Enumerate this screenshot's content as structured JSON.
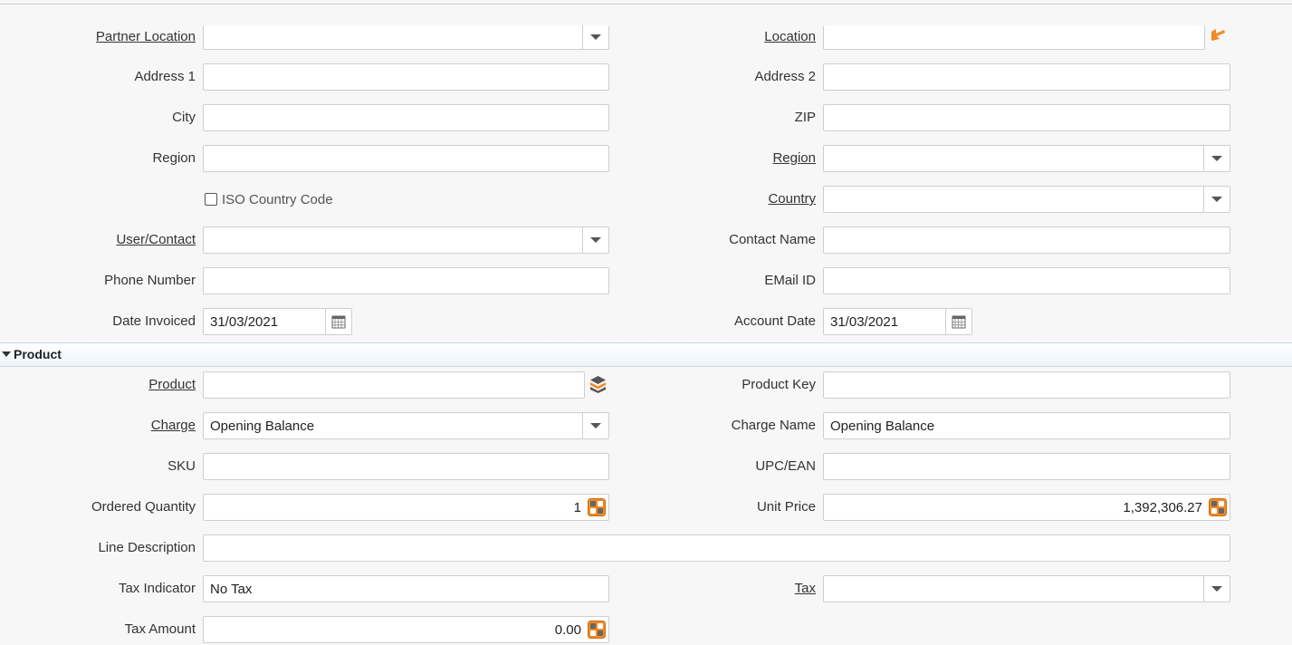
{
  "address": {
    "partner_location": {
      "label": "Partner Location",
      "value": ""
    },
    "location": {
      "label": "Location",
      "value": ""
    },
    "address1": {
      "label": "Address 1",
      "value": ""
    },
    "address2": {
      "label": "Address 2",
      "value": ""
    },
    "city": {
      "label": "City",
      "value": ""
    },
    "zip": {
      "label": "ZIP",
      "value": ""
    },
    "region_text": {
      "label": "Region",
      "value": ""
    },
    "region_select": {
      "label": "Region",
      "value": ""
    },
    "iso_country_code": {
      "label": "ISO Country Code",
      "checked": false
    },
    "country": {
      "label": "Country",
      "value": ""
    },
    "user_contact": {
      "label": "User/Contact",
      "value": ""
    },
    "contact_name": {
      "label": "Contact Name",
      "value": ""
    },
    "phone_number": {
      "label": "Phone Number",
      "value": ""
    },
    "email_id": {
      "label": "EMail ID",
      "value": ""
    },
    "date_invoiced": {
      "label": "Date Invoiced",
      "value": "31/03/2021"
    },
    "account_date": {
      "label": "Account Date",
      "value": "31/03/2021"
    }
  },
  "product_section": {
    "title": "Product",
    "product": {
      "label": "Product",
      "value": ""
    },
    "product_key": {
      "label": "Product Key",
      "value": ""
    },
    "charge": {
      "label": "Charge",
      "value": "Opening Balance"
    },
    "charge_name": {
      "label": "Charge Name",
      "value": "Opening Balance"
    },
    "sku": {
      "label": "SKU",
      "value": ""
    },
    "upc_ean": {
      "label": "UPC/EAN",
      "value": ""
    },
    "ordered_quantity": {
      "label": "Ordered Quantity",
      "value": "1"
    },
    "unit_price": {
      "label": "Unit Price",
      "value": "1,392,306.27"
    },
    "line_description": {
      "label": "Line Description",
      "value": ""
    },
    "tax_indicator": {
      "label": "Tax Indicator",
      "value": "No Tax"
    },
    "tax": {
      "label": "Tax",
      "value": ""
    },
    "tax_amount": {
      "label": "Tax Amount",
      "value": "0.00"
    }
  },
  "colors": {
    "accent_orange": "#f08a24",
    "section_border": "#c9d4e3",
    "field_border": "#cfcfcf"
  },
  "icons": {
    "dropdown": "chevron-down-icon",
    "calendar": "calendar-icon",
    "calculator": "calculator-icon",
    "location_edit": "location-edit-icon",
    "product_info": "product-info-icon"
  }
}
